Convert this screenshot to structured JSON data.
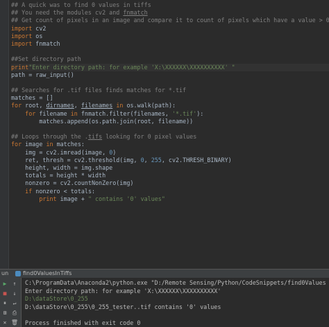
{
  "editor": {
    "lines": [
      [
        {
          "t": "## A quick was to find 0 values in tiffs",
          "c": "comment"
        }
      ],
      [
        {
          "t": "## You need the modules cv2 and ",
          "c": "comment"
        },
        {
          "t": "fnmatch",
          "c": "comment ul"
        }
      ],
      [
        {
          "t": "## Get count of pixels in an image and compare it to count of pixels which have a value > 0",
          "c": "comment"
        }
      ],
      [
        {
          "t": "import",
          "c": "kw"
        },
        {
          "t": " cv2",
          "c": "fn"
        }
      ],
      [
        {
          "t": "import",
          "c": "kw"
        },
        {
          "t": " os",
          "c": "fn"
        }
      ],
      [
        {
          "t": "import",
          "c": "kw"
        },
        {
          "t": " fnmatch",
          "c": "fn"
        }
      ],
      [],
      [
        {
          "t": "##Set directory path",
          "c": "comment"
        }
      ],
      [
        {
          "t": "print",
          "c": "kw"
        },
        {
          "t": "\"Enter directory path: for example 'X:\\XXXXXX\\XXXXXXXXXX' \"",
          "c": "str"
        }
      ],
      [
        {
          "t": "path = raw_input()",
          "c": "fn"
        }
      ],
      [],
      [
        {
          "t": "## Searches for .tif files finds matches for *.tif",
          "c": "comment"
        }
      ],
      [
        {
          "t": "matches = []",
          "c": "fn"
        }
      ],
      [
        {
          "t": "for",
          "c": "kw"
        },
        {
          "t": " root, ",
          "c": "fn"
        },
        {
          "t": "dirnames",
          "c": "fn ul"
        },
        {
          "t": ", ",
          "c": "fn"
        },
        {
          "t": "filenames",
          "c": "fn ul"
        },
        {
          "t": " ",
          "c": "fn"
        },
        {
          "t": "in",
          "c": "kw"
        },
        {
          "t": " os.walk(path):",
          "c": "fn"
        }
      ],
      [
        {
          "t": "    ",
          "c": "fn"
        },
        {
          "t": "for",
          "c": "kw"
        },
        {
          "t": " filename ",
          "c": "fn"
        },
        {
          "t": "in",
          "c": "kw"
        },
        {
          "t": " fnmatch.filter(filenames, ",
          "c": "fn"
        },
        {
          "t": "'*.tif'",
          "c": "str"
        },
        {
          "t": "):",
          "c": "fn"
        }
      ],
      [
        {
          "t": "        matches.append(os.path.join(root, filename))",
          "c": "fn"
        }
      ],
      [],
      [
        {
          "t": "## Loops through the .",
          "c": "comment"
        },
        {
          "t": "tifs",
          "c": "comment ul"
        },
        {
          "t": " looking for 0 pixel values",
          "c": "comment"
        }
      ],
      [
        {
          "t": "for",
          "c": "kw"
        },
        {
          "t": " image ",
          "c": "fn"
        },
        {
          "t": "in",
          "c": "kw"
        },
        {
          "t": " matches:",
          "c": "fn"
        }
      ],
      [
        {
          "t": "    img = cv2.imread(image, ",
          "c": "fn"
        },
        {
          "t": "0",
          "c": "num"
        },
        {
          "t": ")",
          "c": "fn"
        }
      ],
      [
        {
          "t": "    ret, thresh = cv2.threshold(img, ",
          "c": "fn"
        },
        {
          "t": "0",
          "c": "num"
        },
        {
          "t": ", ",
          "c": "fn"
        },
        {
          "t": "255",
          "c": "num"
        },
        {
          "t": ", cv2.THRESH_BINARY)",
          "c": "fn"
        }
      ],
      [
        {
          "t": "    height, width = img.shape",
          "c": "fn"
        }
      ],
      [
        {
          "t": "    totals = height * width",
          "c": "fn"
        }
      ],
      [
        {
          "t": "    nonzero = cv2.countNonZero(img)",
          "c": "fn"
        }
      ],
      [
        {
          "t": "    ",
          "c": "fn"
        },
        {
          "t": "if",
          "c": "kw"
        },
        {
          "t": " nonzero < totals:",
          "c": "fn"
        }
      ],
      [
        {
          "t": "        ",
          "c": "fn"
        },
        {
          "t": "print",
          "c": "kw"
        },
        {
          "t": " image + ",
          "c": "fn"
        },
        {
          "t": "\" contains '0' values\"",
          "c": "str"
        }
      ]
    ]
  },
  "run": {
    "panel_label": "un",
    "tab_name": "find0ValuesInTiffs"
  },
  "console": {
    "lines": [
      {
        "t": "C:\\ProgramData\\Anaconda2\\python.exe \"D:/Remote Sensing/Python/CodeSnippets/find0ValuesInTiffs.py\"",
        "c": "plain"
      },
      {
        "t": "Enter directory path: for example 'X:\\XXXXXX\\XXXXXXXXXX'",
        "c": "plain"
      },
      {
        "t": "D:\\dataStore\\0_255",
        "c": "input"
      },
      {
        "t": "D:\\dataStore\\0_255\\0_255_tester..tif contains '0' values",
        "c": "plain"
      },
      {
        "t": "",
        "c": "plain"
      },
      {
        "t": "Process finished with exit code 0",
        "c": "plain"
      }
    ]
  },
  "colors": {
    "background": "#2b2b2b",
    "comment": "#808080",
    "keyword": "#cc7832",
    "string": "#6a8759",
    "number": "#6897bb",
    "text": "#a9b7c6"
  }
}
